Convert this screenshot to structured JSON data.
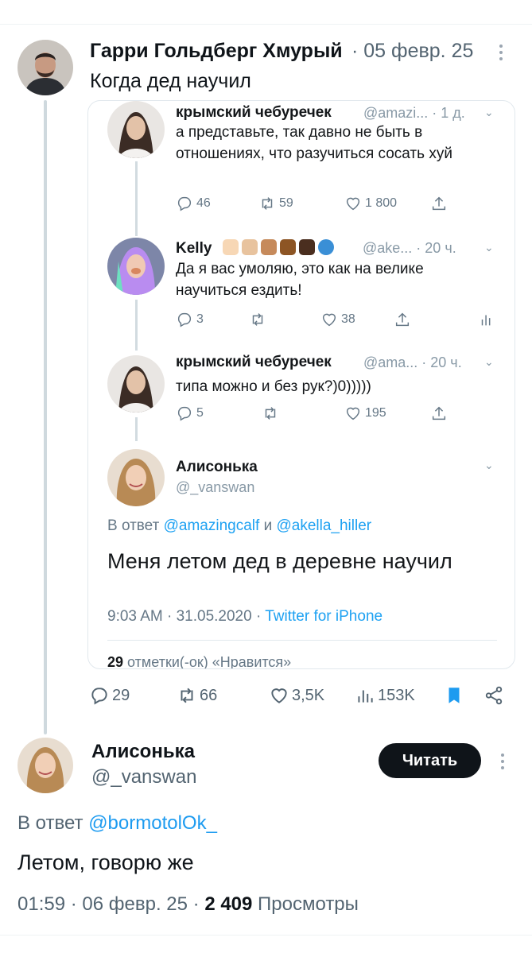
{
  "main_tweet": {
    "author": "Гарри Гольдберг Хмурый",
    "date": "· 05 февр. 25",
    "text": "Когда дед научил",
    "avatar_icon": "man-avatar",
    "actions": {
      "replies": "29",
      "retweets": "66",
      "likes": "3,5K",
      "views": "153K"
    }
  },
  "embedded": {
    "tweets": [
      {
        "name": "крымский чебуречек",
        "handle": "@amazi... · 1 д.",
        "text": "а представьте, так давно не быть в отношениях, что разучиться сосать хуй",
        "replies": "46",
        "retweets": "59",
        "likes": "1 800"
      },
      {
        "name": "Kelly",
        "handle": "@ake... · 20 ч.",
        "text": "Да я вас умоляю, это как на велике научиться ездить!",
        "replies": "3",
        "retweets": "",
        "likes": "38"
      },
      {
        "name": "крымский чебуречек",
        "handle": "@ama... · 20 ч.",
        "text": "типа можно и без рук?)0)))))",
        "replies": "5",
        "retweets": "",
        "likes": "195"
      }
    ],
    "focus": {
      "name": "Алисонька",
      "handle": "@_vanswan",
      "reply_prefix": "В ответ",
      "reply_to_1": "@amazingcalf",
      "reply_and": "и",
      "reply_to_2": "@akella_hiller",
      "text": "Меня летом дед в деревне научил",
      "time": "9:03 AM · 31.05.2020 ·",
      "source": "Twitter for iPhone",
      "likes_count": "29",
      "likes_label": "отметки(-ок) «Нравится»"
    },
    "kelly_emoji_colors": [
      "#f7d7b5",
      "#e8c39e",
      "#c68a5b",
      "#8d5524",
      "#4a2e1f"
    ]
  },
  "reply_tweet": {
    "name": "Алисонька",
    "handle": "@_vanswan",
    "follow_label": "Читать",
    "reply_prefix": "В ответ",
    "reply_to": "@bormotolOk_",
    "text": "Летом, говорю же",
    "time": "01:59 · 06 февр. 25 ·",
    "views_count": "2 409",
    "views_label": "Просмотры"
  },
  "colors": {
    "bookmark_active": "#1d9bf0",
    "follow_bg": "#0f1419",
    "link": "#1da1f2"
  }
}
